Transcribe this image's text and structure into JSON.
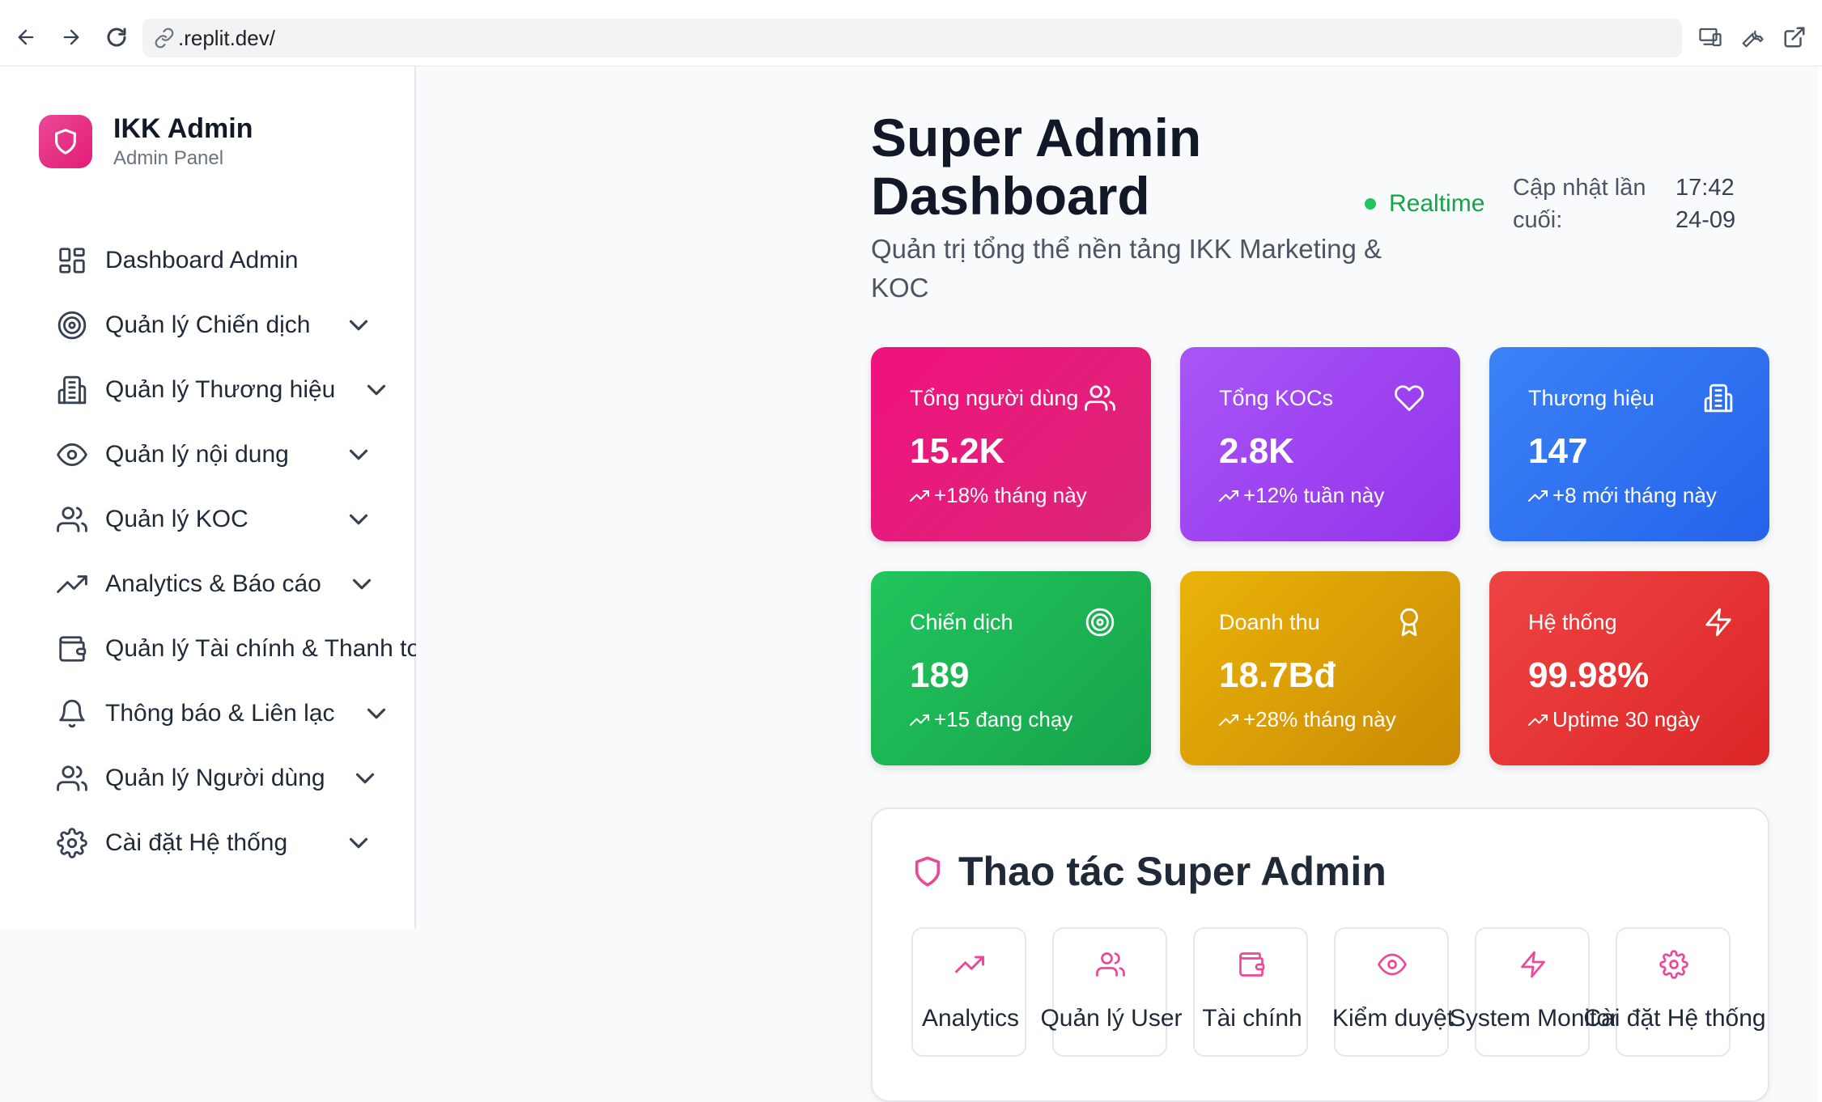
{
  "browser": {
    "url": ".replit.dev/"
  },
  "sidebar": {
    "brand_title": "IKK Admin",
    "brand_subtitle": "Admin Panel",
    "items": [
      {
        "label": "Dashboard Admin",
        "icon": "grid-icon",
        "expandable": false
      },
      {
        "label": "Quản lý Chiến dịch",
        "icon": "target-icon",
        "expandable": true
      },
      {
        "label": "Quản lý Thương hiệu",
        "icon": "building-icon",
        "expandable": true
      },
      {
        "label": "Quản lý nội dung",
        "icon": "eye-icon",
        "expandable": true
      },
      {
        "label": "Quản lý KOC",
        "icon": "users-icon",
        "expandable": true
      },
      {
        "label": "Analytics & Báo cáo",
        "icon": "trending-up-icon",
        "expandable": true
      },
      {
        "label": "Quản lý Tài chính & Thanh toán",
        "icon": "wallet-icon",
        "expandable": false
      },
      {
        "label": "Thông báo & Liên lạc",
        "icon": "bell-icon",
        "expandable": true
      },
      {
        "label": "Quản lý Người dùng",
        "icon": "users-icon",
        "expandable": true
      },
      {
        "label": "Cài đặt Hệ thống",
        "icon": "gear-icon",
        "expandable": true
      }
    ]
  },
  "header": {
    "title": "Super Admin Dashboard",
    "subtitle": "Quản trị tổng thể nền tảng IKK Marketing & KOC",
    "realtime_label": "Realtime",
    "last_update_label": "Cập nhật lần cuối:",
    "last_update_value": "17:42 24-09"
  },
  "stats": [
    {
      "label": "Tổng người dùng",
      "value": "15.2K",
      "trend": "+18% tháng này",
      "icon": "users-icon",
      "color": "#f0127e"
    },
    {
      "label": "Tổng KOCs",
      "value": "2.8K",
      "trend": "+12% tuần này",
      "icon": "heart-icon",
      "color": "#a855f7"
    },
    {
      "label": "Thương hiệu",
      "value": "147",
      "trend": "+8 mới tháng này",
      "icon": "building-icon",
      "color": "#3b82f6"
    },
    {
      "label": "Chiến dịch",
      "value": "189",
      "trend": "+15 đang chạy",
      "icon": "target-icon",
      "color": "#22c55e"
    },
    {
      "label": "Doanh thu",
      "value": "18.7Bđ",
      "trend": "+28% tháng này",
      "icon": "award-icon",
      "color": "#eab308"
    },
    {
      "label": "Hệ thống",
      "value": "99.98%",
      "trend": "Uptime 30 ngày",
      "icon": "lightning-icon",
      "color": "#ef4444"
    }
  ],
  "actions": {
    "title": "Thao tác Super Admin",
    "items": [
      {
        "label": "Analytics",
        "icon": "trending-up-icon"
      },
      {
        "label": "Quản lý User",
        "icon": "users-icon"
      },
      {
        "label": "Tài chính",
        "icon": "wallet-icon"
      },
      {
        "label": "Kiểm duyệt",
        "icon": "eye-icon"
      },
      {
        "label": "System Monitor",
        "icon": "lightning-icon"
      },
      {
        "label": "Cài đặt Hệ thống",
        "icon": "gear-icon"
      }
    ]
  },
  "colors": {
    "accent": "#ec4899",
    "realtime": "#16a34a"
  }
}
